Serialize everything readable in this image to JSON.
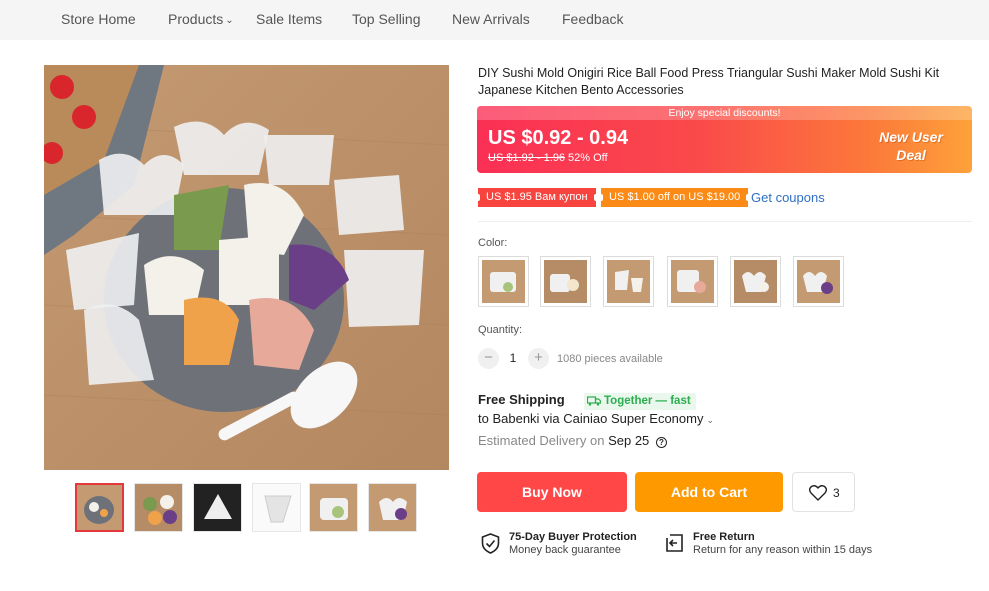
{
  "nav": {
    "items": [
      "Store Home",
      "Products",
      "Sale Items",
      "Top Selling",
      "New Arrivals",
      "Feedback"
    ]
  },
  "product": {
    "title": "DIY Sushi Mold Onigiri Rice Ball Food Press Triangular Sushi Maker Mold Sushi Kit Japanese Kitchen Bento Accessories"
  },
  "promo": {
    "banner": "Enjoy special discounts!",
    "price": "US $0.92 - 0.94",
    "original_price": "US $1.92 - 1.96",
    "discount": "52% Off",
    "badge": "New User Deal",
    "colors": {
      "start": "#fb2f55",
      "end": "#fda23a"
    }
  },
  "coupons": {
    "items": [
      "US $1.95 Вам купон",
      "US $1.00 off on US $19.00"
    ],
    "link": "Get coupons"
  },
  "options": {
    "color_label": "Color:",
    "swatch_count": 6
  },
  "quantity": {
    "label": "Quantity:",
    "value": "1",
    "available": "1080 pieces available"
  },
  "shipping": {
    "title": "Free Shipping",
    "tag": "Together — fast",
    "to": "to Babenki via Cainiao Super Economy",
    "estimated_label": "Estimated Delivery on",
    "estimated_date": "Sep 25"
  },
  "actions": {
    "buy_now": "Buy Now",
    "add_to_cart": "Add to Cart",
    "wishlist_count": "3",
    "buy_color": "#ff4747",
    "cart_color": "#ff9900"
  },
  "guarantees": {
    "protection_title": "75-Day Buyer Protection",
    "protection_sub": "Money back guarantee",
    "return_title": "Free Return",
    "return_sub": "Return for any reason within 15 days"
  },
  "icons": {
    "protection": "shield-check-icon",
    "return": "return-box-icon",
    "wishlist": "heart-icon",
    "help": "question-circle-icon",
    "truck": "truck-icon"
  }
}
